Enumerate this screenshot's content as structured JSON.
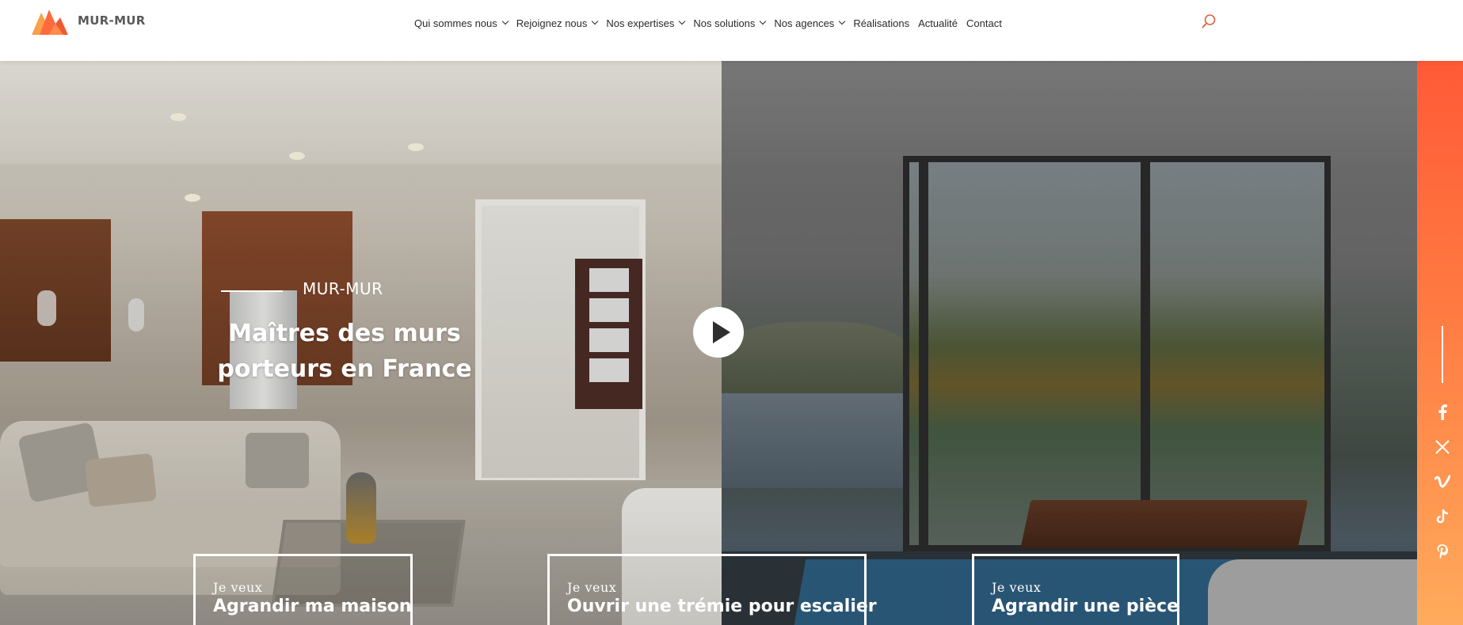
{
  "header": {
    "brand": "MUR-MUR",
    "nav": [
      {
        "label": "Qui sommes nous",
        "dropdown": true
      },
      {
        "label": "Rejoignez nous",
        "dropdown": true
      },
      {
        "label": "Nos expertises",
        "dropdown": true
      },
      {
        "label": "Nos solutions",
        "dropdown": true
      },
      {
        "label": "Nos agences",
        "dropdown": true
      },
      {
        "label": "Réalisations",
        "dropdown": false
      },
      {
        "label": "Actualité",
        "dropdown": false
      },
      {
        "label": "Contact",
        "dropdown": false
      }
    ],
    "search_icon": "search-icon"
  },
  "hero": {
    "kicker": "MUR-MUR",
    "headline": "Maîtres des murs porteurs en France",
    "play_icon": "play-icon",
    "ctas": [
      {
        "small": "Je veux",
        "big": "Agrandir ma maison"
      },
      {
        "small": "Je veux",
        "big": "Ouvrir une trémie pour escalier"
      },
      {
        "small": "Je veux",
        "big": "Agrandir une pièce"
      }
    ]
  },
  "social": {
    "icons": [
      "facebook-icon",
      "x-icon",
      "vimeo-icon",
      "tiktok-icon",
      "pinterest-icon"
    ]
  },
  "colors": {
    "accent": "#ff6a3d",
    "accent_light": "#ffab5c",
    "search_icon": "#e0603e"
  }
}
